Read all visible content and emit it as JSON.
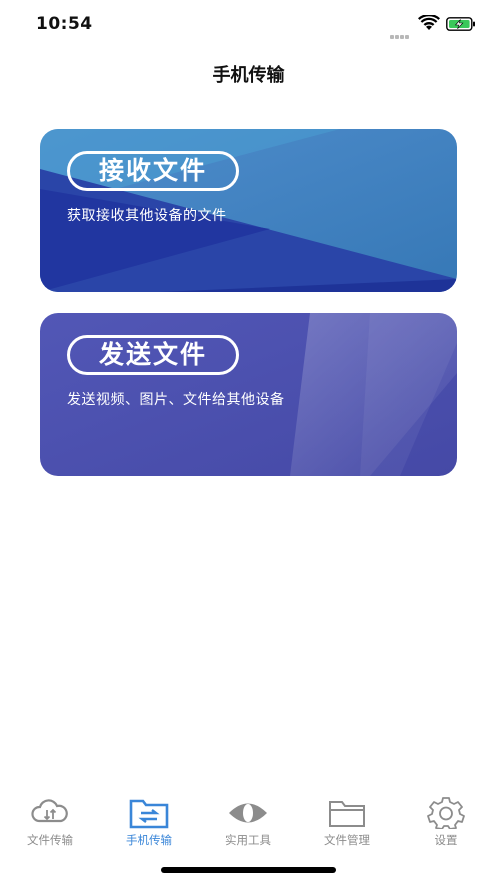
{
  "status_bar": {
    "time": "10:54"
  },
  "header": {
    "title": "手机传输"
  },
  "cards": [
    {
      "title": "接收文件",
      "subtitle": "获取接收其他设备的文件"
    },
    {
      "title": "发送文件",
      "subtitle": "发送视频、图片、文件给其他设备"
    }
  ],
  "tabs": [
    {
      "label": "文件传输",
      "icon": "cloud-transfer-icon"
    },
    {
      "label": "手机传输",
      "icon": "folder-transfer-icon",
      "active": true
    },
    {
      "label": "实用工具",
      "icon": "eye-icon"
    },
    {
      "label": "文件管理",
      "icon": "folder-icon"
    },
    {
      "label": "设置",
      "icon": "gear-icon"
    }
  ],
  "colors": {
    "accent": "#3a86d8",
    "inactive": "#8c8c8c",
    "receive_card": "#2b4fb4",
    "send_card": "#4e53b0"
  }
}
